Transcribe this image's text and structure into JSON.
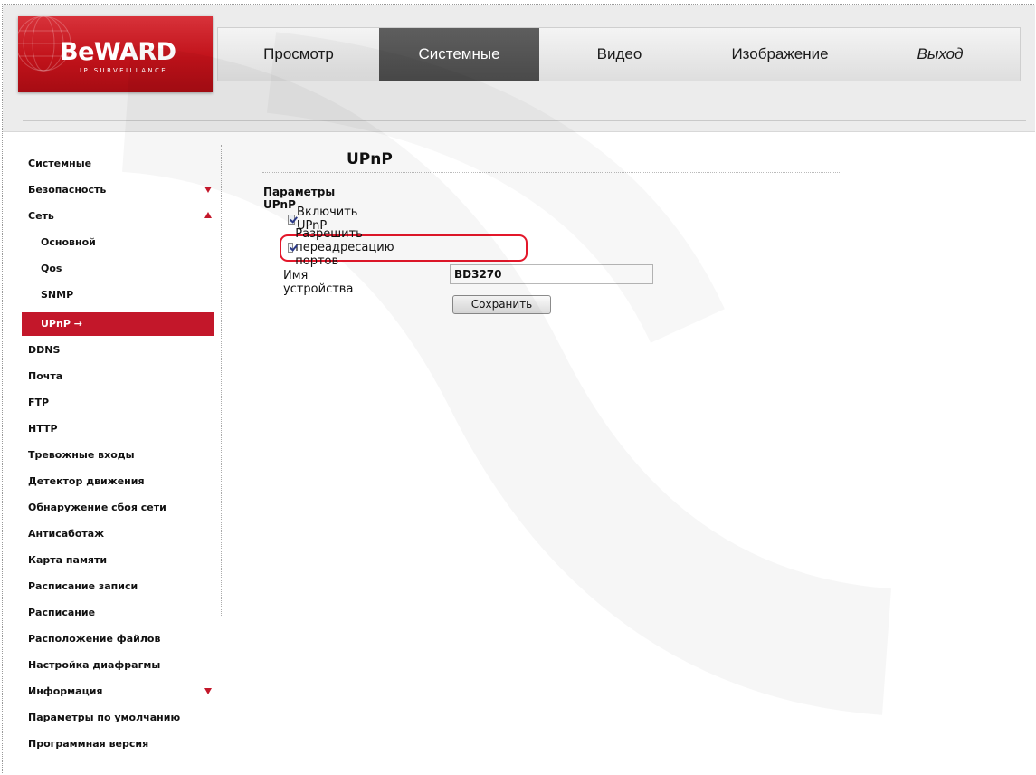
{
  "brand": {
    "name": "BeWARD",
    "tagline": "IP SURVEILLANCE",
    "color": "#c3172a"
  },
  "nav": {
    "tabs": [
      {
        "label": "Просмотр",
        "active": false
      },
      {
        "label": "Системные",
        "active": true
      },
      {
        "label": "Видео",
        "active": false
      },
      {
        "label": "Изображение",
        "active": false
      },
      {
        "label": "Выход",
        "active": false
      }
    ]
  },
  "sidebar": {
    "items": [
      {
        "label": "Системные"
      },
      {
        "label": "Безопасность",
        "arrow": "down"
      },
      {
        "label": "Сеть",
        "arrow": "up"
      },
      {
        "label": "Основной"
      },
      {
        "label": "Qos"
      },
      {
        "label": "SNMP"
      },
      {
        "label": "UPnP →",
        "active": true
      },
      {
        "label": "DDNS"
      },
      {
        "label": "Почта"
      },
      {
        "label": "FTP"
      },
      {
        "label": "HTTP"
      },
      {
        "label": "Тревожные входы"
      },
      {
        "label": "Детектор движения"
      },
      {
        "label": "Обнаружение сбоя сети"
      },
      {
        "label": "Антисаботаж"
      },
      {
        "label": "Карта памяти"
      },
      {
        "label": "Расписание записи"
      },
      {
        "label": "Расписание"
      },
      {
        "label": "Расположение файлов"
      },
      {
        "label": "Настройка диафрагмы"
      },
      {
        "label": "Информация",
        "arrow": "down"
      },
      {
        "label": "Параметры по умолчанию"
      },
      {
        "label": "Программная версия"
      }
    ]
  },
  "main": {
    "title": "UPnP",
    "section_title": "Параметры UPnP",
    "enable_upnp_label": "Включить UPnP",
    "enable_upnp_checked": true,
    "port_forward_label": "Разрешить переадресацию портов",
    "port_forward_checked": true,
    "device_name_label": "Имя устройства",
    "device_name_value": "BD3270",
    "save_label": "Сохранить"
  }
}
